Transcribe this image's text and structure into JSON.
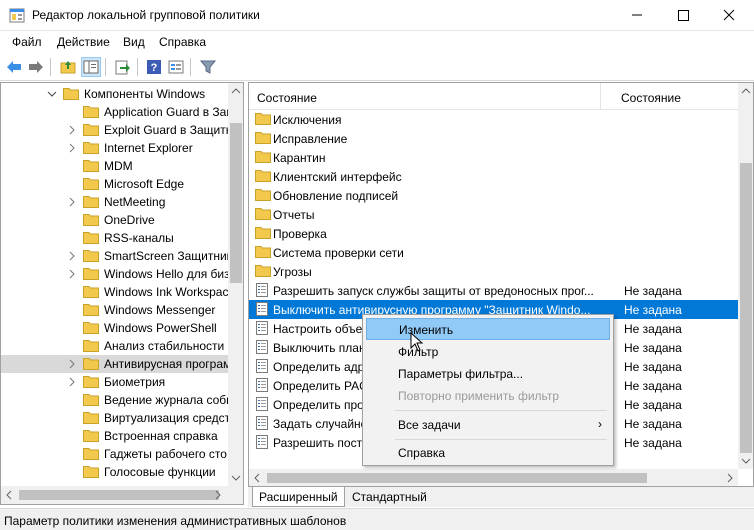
{
  "window": {
    "title": "Редактор локальной групповой политики"
  },
  "menu": [
    "Файл",
    "Действие",
    "Вид",
    "Справка"
  ],
  "toolbar_icons": [
    "back-arrow-icon",
    "forward-arrow-icon",
    "up-folder-icon",
    "show-hide-tree-icon",
    "export-list-icon",
    "help-icon",
    "properties-icon",
    "filter-icon"
  ],
  "tree": {
    "items": [
      {
        "label": "Компоненты Windows",
        "expanded": true
      },
      {
        "label": "Application Guard в Защ",
        "expandable": false
      },
      {
        "label": "Exploit Guard в Защитн",
        "expandable": true
      },
      {
        "label": "Internet Explorer",
        "expandable": true
      },
      {
        "label": "MDM",
        "expandable": false
      },
      {
        "label": "Microsoft Edge",
        "expandable": false
      },
      {
        "label": "NetMeeting",
        "expandable": true
      },
      {
        "label": "OneDrive",
        "expandable": false
      },
      {
        "label": "RSS-каналы",
        "expandable": false
      },
      {
        "label": "SmartScreen Защитник",
        "expandable": true
      },
      {
        "label": "Windows Hello для биз",
        "expandable": true
      },
      {
        "label": "Windows Ink Workspac",
        "expandable": false
      },
      {
        "label": "Windows Messenger",
        "expandable": false
      },
      {
        "label": "Windows PowerShell",
        "expandable": false
      },
      {
        "label": "Анализ стабильности",
        "expandable": false
      },
      {
        "label": "Антивирусная програм",
        "expandable": true,
        "selected": true
      },
      {
        "label": "Биометрия",
        "expandable": true
      },
      {
        "label": "Ведение журнала собы",
        "expandable": false
      },
      {
        "label": "Виртуализация средст",
        "expandable": false
      },
      {
        "label": "Встроенная справка",
        "expandable": false
      },
      {
        "label": "Гаджеты рабочего сто",
        "expandable": false
      },
      {
        "label": "Голосовые функции",
        "expandable": false
      }
    ]
  },
  "list": {
    "columns": [
      "Состояние",
      "Состояние"
    ],
    "rows": [
      {
        "name": "Исключения",
        "type": "folder",
        "state": ""
      },
      {
        "name": "Исправление",
        "type": "folder",
        "state": ""
      },
      {
        "name": "Карантин",
        "type": "folder",
        "state": ""
      },
      {
        "name": "Клиентский интерфейс",
        "type": "folder",
        "state": ""
      },
      {
        "name": "Обновление подписей",
        "type": "folder",
        "state": ""
      },
      {
        "name": "Отчеты",
        "type": "folder",
        "state": ""
      },
      {
        "name": "Проверка",
        "type": "folder",
        "state": ""
      },
      {
        "name": "Система проверки сети",
        "type": "folder",
        "state": ""
      },
      {
        "name": "Угрозы",
        "type": "folder",
        "state": ""
      },
      {
        "name": "Разрешить запуск службы защиты от вредоносных прог...",
        "type": "policy",
        "state": "Не задана"
      },
      {
        "name": "Выключить антивирусную программу \"Защитник Windo...",
        "type": "policy",
        "state": "Не задана",
        "selected": true
      },
      {
        "name": "Настроить объе",
        "type": "policy",
        "state": "Не задана"
      },
      {
        "name": "Выключить план",
        "type": "policy",
        "state": "Не задана"
      },
      {
        "name": "Определить адр",
        "type": "policy",
        "state": "Не задана"
      },
      {
        "name": "Определить PAC",
        "type": "policy",
        "state": "Не задана"
      },
      {
        "name": "Определить про",
        "type": "policy",
        "state": "Не задана"
      },
      {
        "name": "Задать случайно",
        "type": "policy",
        "state": "Не задана"
      },
      {
        "name": "Разрешить посто",
        "type": "policy",
        "state": "Не задана"
      }
    ]
  },
  "tabs": [
    "Расширенный",
    "Стандартный"
  ],
  "context_menu": {
    "items": [
      {
        "label": "Изменить",
        "highlighted": true
      },
      {
        "label": "Фильтр"
      },
      {
        "label": "Параметры фильтра..."
      },
      {
        "label": "Повторно применить фильтр",
        "disabled": true
      },
      {
        "label": "Все задачи",
        "submenu": true
      },
      {
        "label": "Справка"
      }
    ]
  },
  "status": "Параметр политики изменения административных шаблонов",
  "colors": {
    "selection": "#0078d7",
    "menu_highlight": "#91c9f7",
    "folder": "#f2c94c"
  }
}
